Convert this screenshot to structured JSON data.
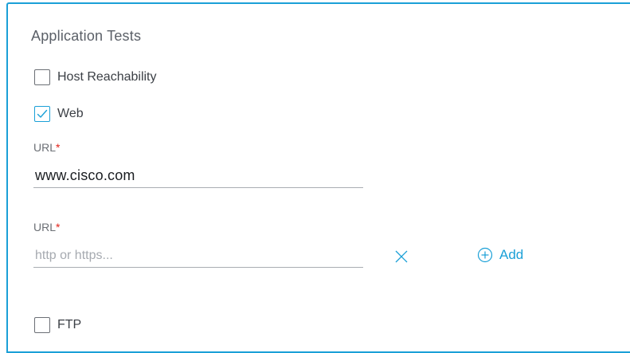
{
  "section": {
    "title": "Application Tests"
  },
  "checkboxes": [
    {
      "label": "Host Reachability",
      "checked": false
    },
    {
      "label": "Web",
      "checked": true
    },
    {
      "label": "FTP",
      "checked": false
    }
  ],
  "url_fields": [
    {
      "label": "URL",
      "required_marker": "*",
      "value": "www.cisco.com",
      "placeholder": ""
    },
    {
      "label": "URL",
      "required_marker": "*",
      "value": "",
      "placeholder": "http or https..."
    }
  ],
  "actions": {
    "clear_icon": "close-icon",
    "add_icon": "plus-circle-icon",
    "add_label": "Add"
  },
  "colors": {
    "accent": "#1ba0d7",
    "required": "#e2231a"
  }
}
